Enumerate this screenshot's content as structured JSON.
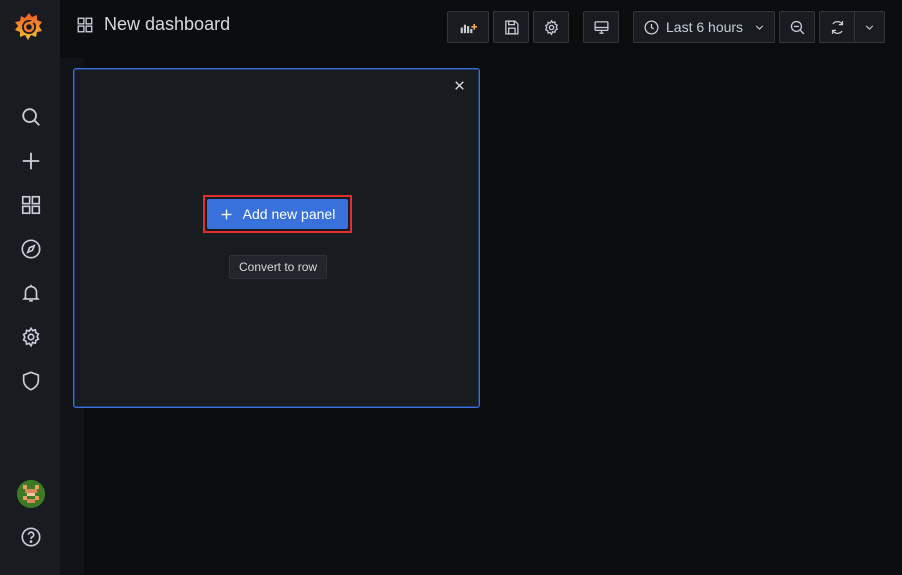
{
  "header": {
    "title": "New dashboard",
    "time_range": "Last 6 hours"
  },
  "sidebar": {
    "items": [
      {
        "icon": "search-icon"
      },
      {
        "icon": "plus-icon"
      },
      {
        "icon": "dashboards-icon"
      },
      {
        "icon": "compass-icon"
      },
      {
        "icon": "bell-icon"
      },
      {
        "icon": "gear-icon"
      },
      {
        "icon": "shield-icon"
      }
    ],
    "help_icon": "help-icon"
  },
  "panel": {
    "add_label": "Add new panel",
    "convert_label": "Convert to row"
  },
  "colors": {
    "accent": "#3871dc",
    "highlight": "#e02f2f",
    "logo_orange": "#f05a28"
  }
}
